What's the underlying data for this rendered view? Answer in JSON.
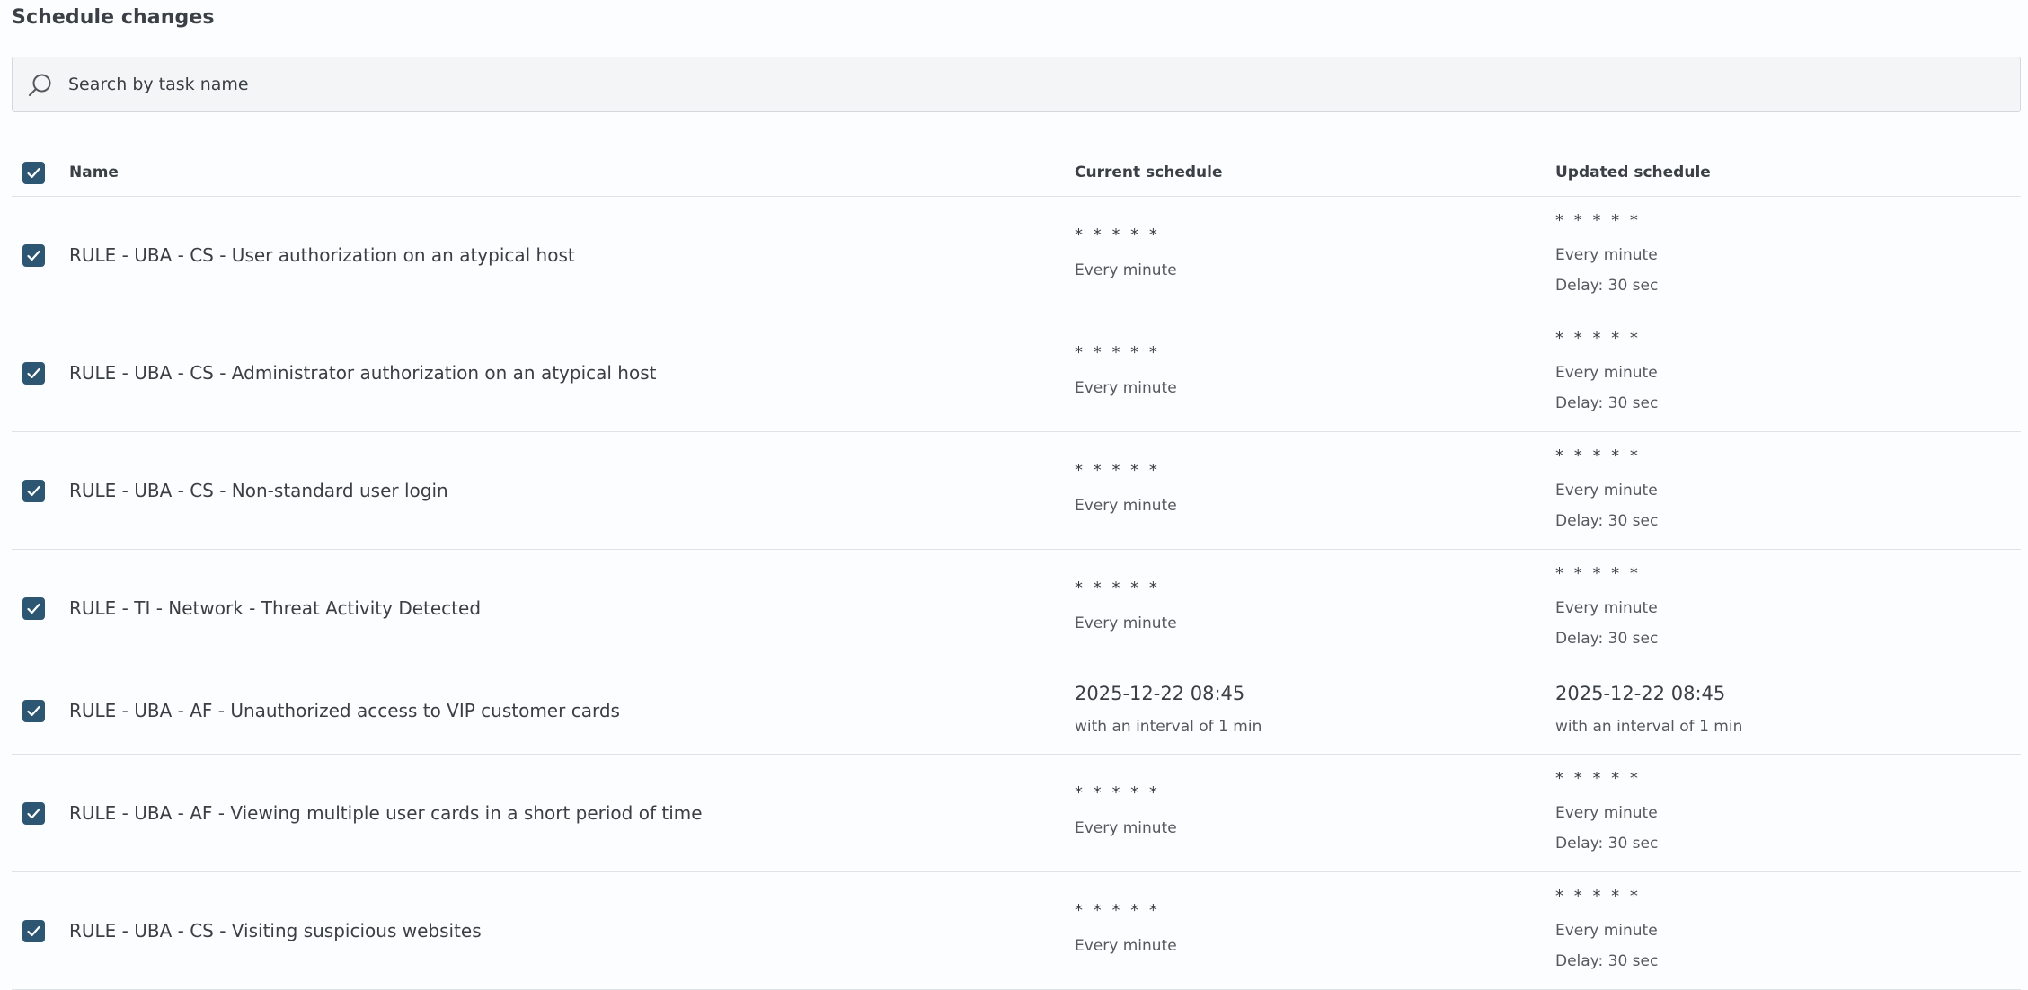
{
  "page": {
    "title": "Schedule changes"
  },
  "search": {
    "placeholder": "Search by task name",
    "icon": "search-icon"
  },
  "table": {
    "columns": {
      "name": "Name",
      "current": "Current schedule",
      "updated": "Updated schedule"
    },
    "select_all_checked": true,
    "rows": [
      {
        "name": "RULE - UBA - CS - User authorization on an atypical host",
        "checked": true,
        "current": {
          "cron": "* * * * *",
          "text": "Every minute"
        },
        "updated": {
          "cron": "* * * * *",
          "text": "Every minute",
          "delay": "Delay: 30 sec"
        }
      },
      {
        "name": "RULE - UBA - CS - Administrator authorization on an atypical host",
        "checked": true,
        "current": {
          "cron": "* * * * *",
          "text": "Every minute"
        },
        "updated": {
          "cron": "* * * * *",
          "text": "Every minute",
          "delay": "Delay: 30 sec"
        }
      },
      {
        "name": "RULE - UBA - CS - Non-standard user login",
        "checked": true,
        "current": {
          "cron": "* * * * *",
          "text": "Every minute"
        },
        "updated": {
          "cron": "* * * * *",
          "text": "Every minute",
          "delay": "Delay: 30 sec"
        }
      },
      {
        "name": "RULE - TI - Network - Threat Activity Detected",
        "checked": true,
        "current": {
          "cron": "* * * * *",
          "text": "Every minute"
        },
        "updated": {
          "cron": "* * * * *",
          "text": "Every minute",
          "delay": "Delay: 30 sec"
        }
      },
      {
        "name": "RULE - UBA - AF - Unauthorized access to VIP customer cards",
        "checked": true,
        "current": {
          "datetime": "2025-12-22 08:45",
          "text": "with an interval of 1 min"
        },
        "updated": {
          "datetime": "2025-12-22 08:45",
          "text": "with an interval of 1 min"
        }
      },
      {
        "name": "RULE - UBA - AF - Viewing multiple user cards in a short period of time",
        "checked": true,
        "current": {
          "cron": "* * * * *",
          "text": "Every minute"
        },
        "updated": {
          "cron": "* * * * *",
          "text": "Every minute",
          "delay": "Delay: 30 sec"
        }
      },
      {
        "name": "RULE - UBA - CS - Visiting suspicious websites",
        "checked": true,
        "current": {
          "cron": "* * * * *",
          "text": "Every minute"
        },
        "updated": {
          "cron": "* * * * *",
          "text": "Every minute",
          "delay": "Delay: 30 sec"
        }
      }
    ]
  },
  "colors": {
    "checkbox": "#2d5673",
    "search_bg": "#f4f5f6",
    "divider": "#dfe3e6",
    "text": "#3a3f44"
  }
}
